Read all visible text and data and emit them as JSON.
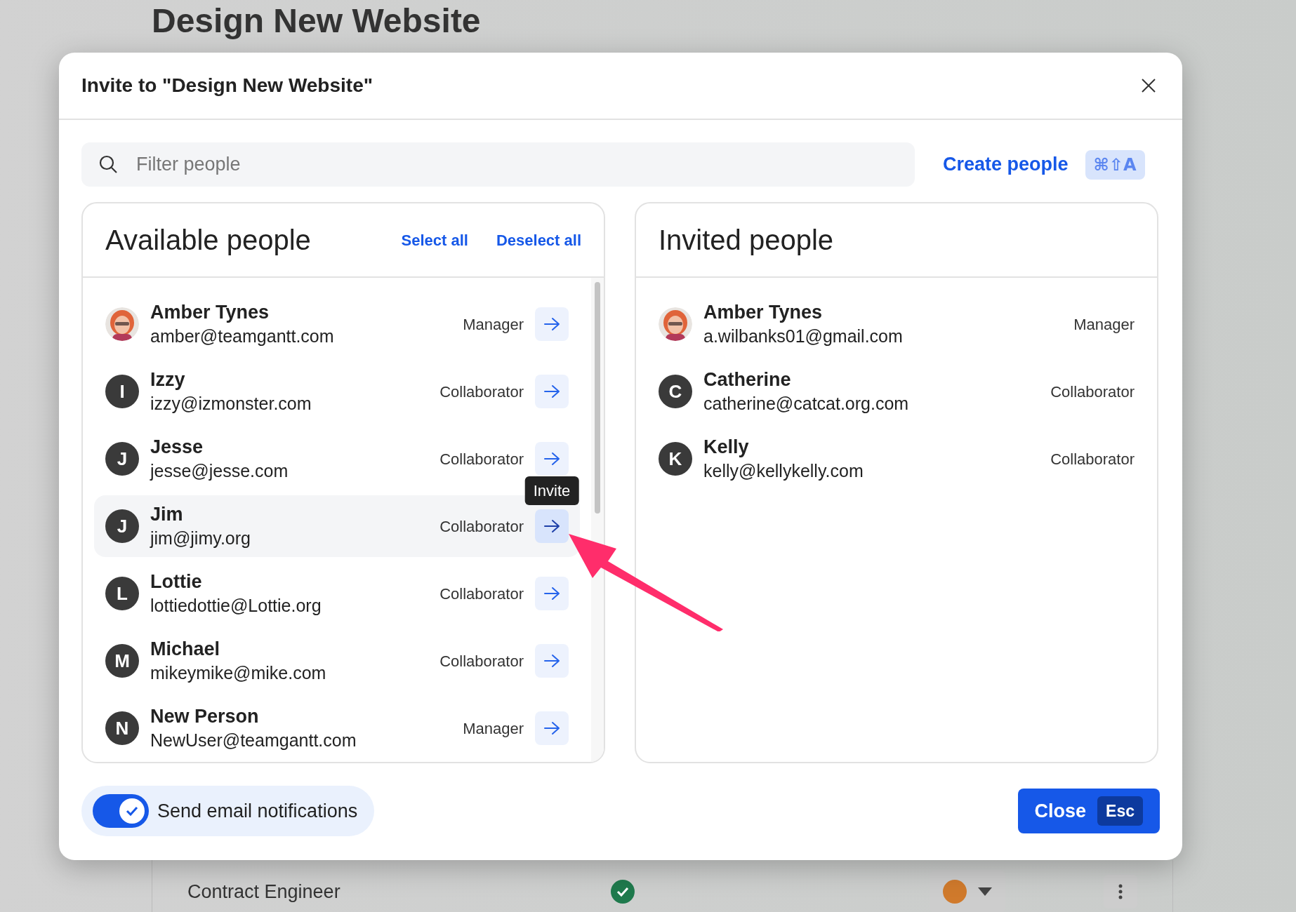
{
  "background_page": {
    "title": "Design New Website",
    "row": {
      "name": "Contract Engineer",
      "done": true
    }
  },
  "dialog": {
    "title": "Invite to \"Design New Website\"",
    "search": {
      "placeholder": "Filter people"
    },
    "create_link": "Create people",
    "create_shortcut": "⌘⇧A",
    "available": {
      "title": "Available people",
      "select_all": "Select all",
      "deselect_all": "Deselect all",
      "people": [
        {
          "name": "Amber Tynes",
          "email": "amber@teamgantt.com",
          "role": "Manager",
          "hovered": false
        },
        {
          "avatar": {
            "kind": "initial",
            "text": "I"
          },
          "name": "Izzy",
          "email": "izzy@izmonster.com",
          "role": "Collaborator",
          "hovered": false
        },
        {
          "avatar": {
            "kind": "initial",
            "text": "J"
          },
          "name": "Jesse",
          "email": "jesse@jesse.com",
          "role": "Collaborator",
          "hovered": false
        },
        {
          "avatar": {
            "kind": "initial",
            "text": "J"
          },
          "name": "Jim",
          "email": "jim@jimy.org",
          "role": "Collaborator",
          "hovered": true,
          "tooltip": "Invite"
        },
        {
          "avatar": {
            "kind": "initial",
            "text": "L"
          },
          "name": "Lottie",
          "email": "lottiedottie@Lottie.org",
          "role": "Collaborator",
          "hovered": false
        },
        {
          "avatar": {
            "kind": "initial",
            "text": "M"
          },
          "name": "Michael",
          "email": "mikeymike@mike.com",
          "role": "Collaborator",
          "hovered": false
        },
        {
          "avatar": {
            "kind": "initial",
            "text": "N"
          },
          "name": "New Person",
          "email": "NewUser@teamgantt.com",
          "role": "Manager",
          "hovered": false
        }
      ]
    },
    "invited": {
      "title": "Invited people",
      "people": [
        {
          "name": "Amber Tynes",
          "email": "a.wilbanks01@gmail.com",
          "role": "Manager"
        },
        {
          "avatar": {
            "kind": "initial",
            "text": "C"
          },
          "name": "Catherine",
          "email": "catherine@catcat.org.com",
          "role": "Collaborator"
        },
        {
          "avatar": {
            "kind": "initial",
            "text": "K"
          },
          "name": "Kelly",
          "email": "kelly@kellykelly.com",
          "role": "Collaborator"
        }
      ]
    },
    "email_toggle": {
      "label": "Send email notifications",
      "on": true
    },
    "close_button": {
      "label": "Close",
      "shortcut": "Esc"
    }
  }
}
